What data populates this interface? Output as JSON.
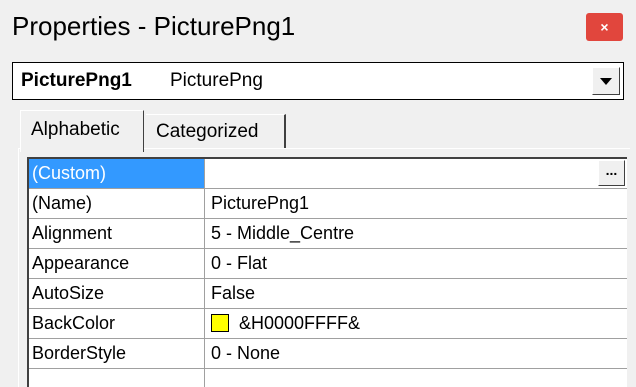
{
  "window": {
    "title": "Properties - PicturePng1",
    "close_glyph": "×"
  },
  "object_selector": {
    "name": "PicturePng1",
    "type": "PicturePng"
  },
  "tabs": [
    {
      "label": "Alphabetic",
      "active": true
    },
    {
      "label": "Categorized",
      "active": false
    }
  ],
  "properties": [
    {
      "name": "(Custom)",
      "value": "",
      "selected": true,
      "has_button": true,
      "button_label": "..."
    },
    {
      "name": "(Name)",
      "value": "PicturePng1"
    },
    {
      "name": "Alignment",
      "value": "5 - Middle_Centre"
    },
    {
      "name": "Appearance",
      "value": "0 - Flat"
    },
    {
      "name": "AutoSize",
      "value": "False"
    },
    {
      "name": "BackColor",
      "value": "&H0000FFFF&",
      "swatch_color": "#ffff00"
    },
    {
      "name": "BorderStyle",
      "value": "0 - None"
    },
    {
      "name": "",
      "value": ""
    }
  ],
  "colors": {
    "selection": "#3399ff",
    "close_button": "#e1463d",
    "window_bg": "#f0f0f0"
  }
}
